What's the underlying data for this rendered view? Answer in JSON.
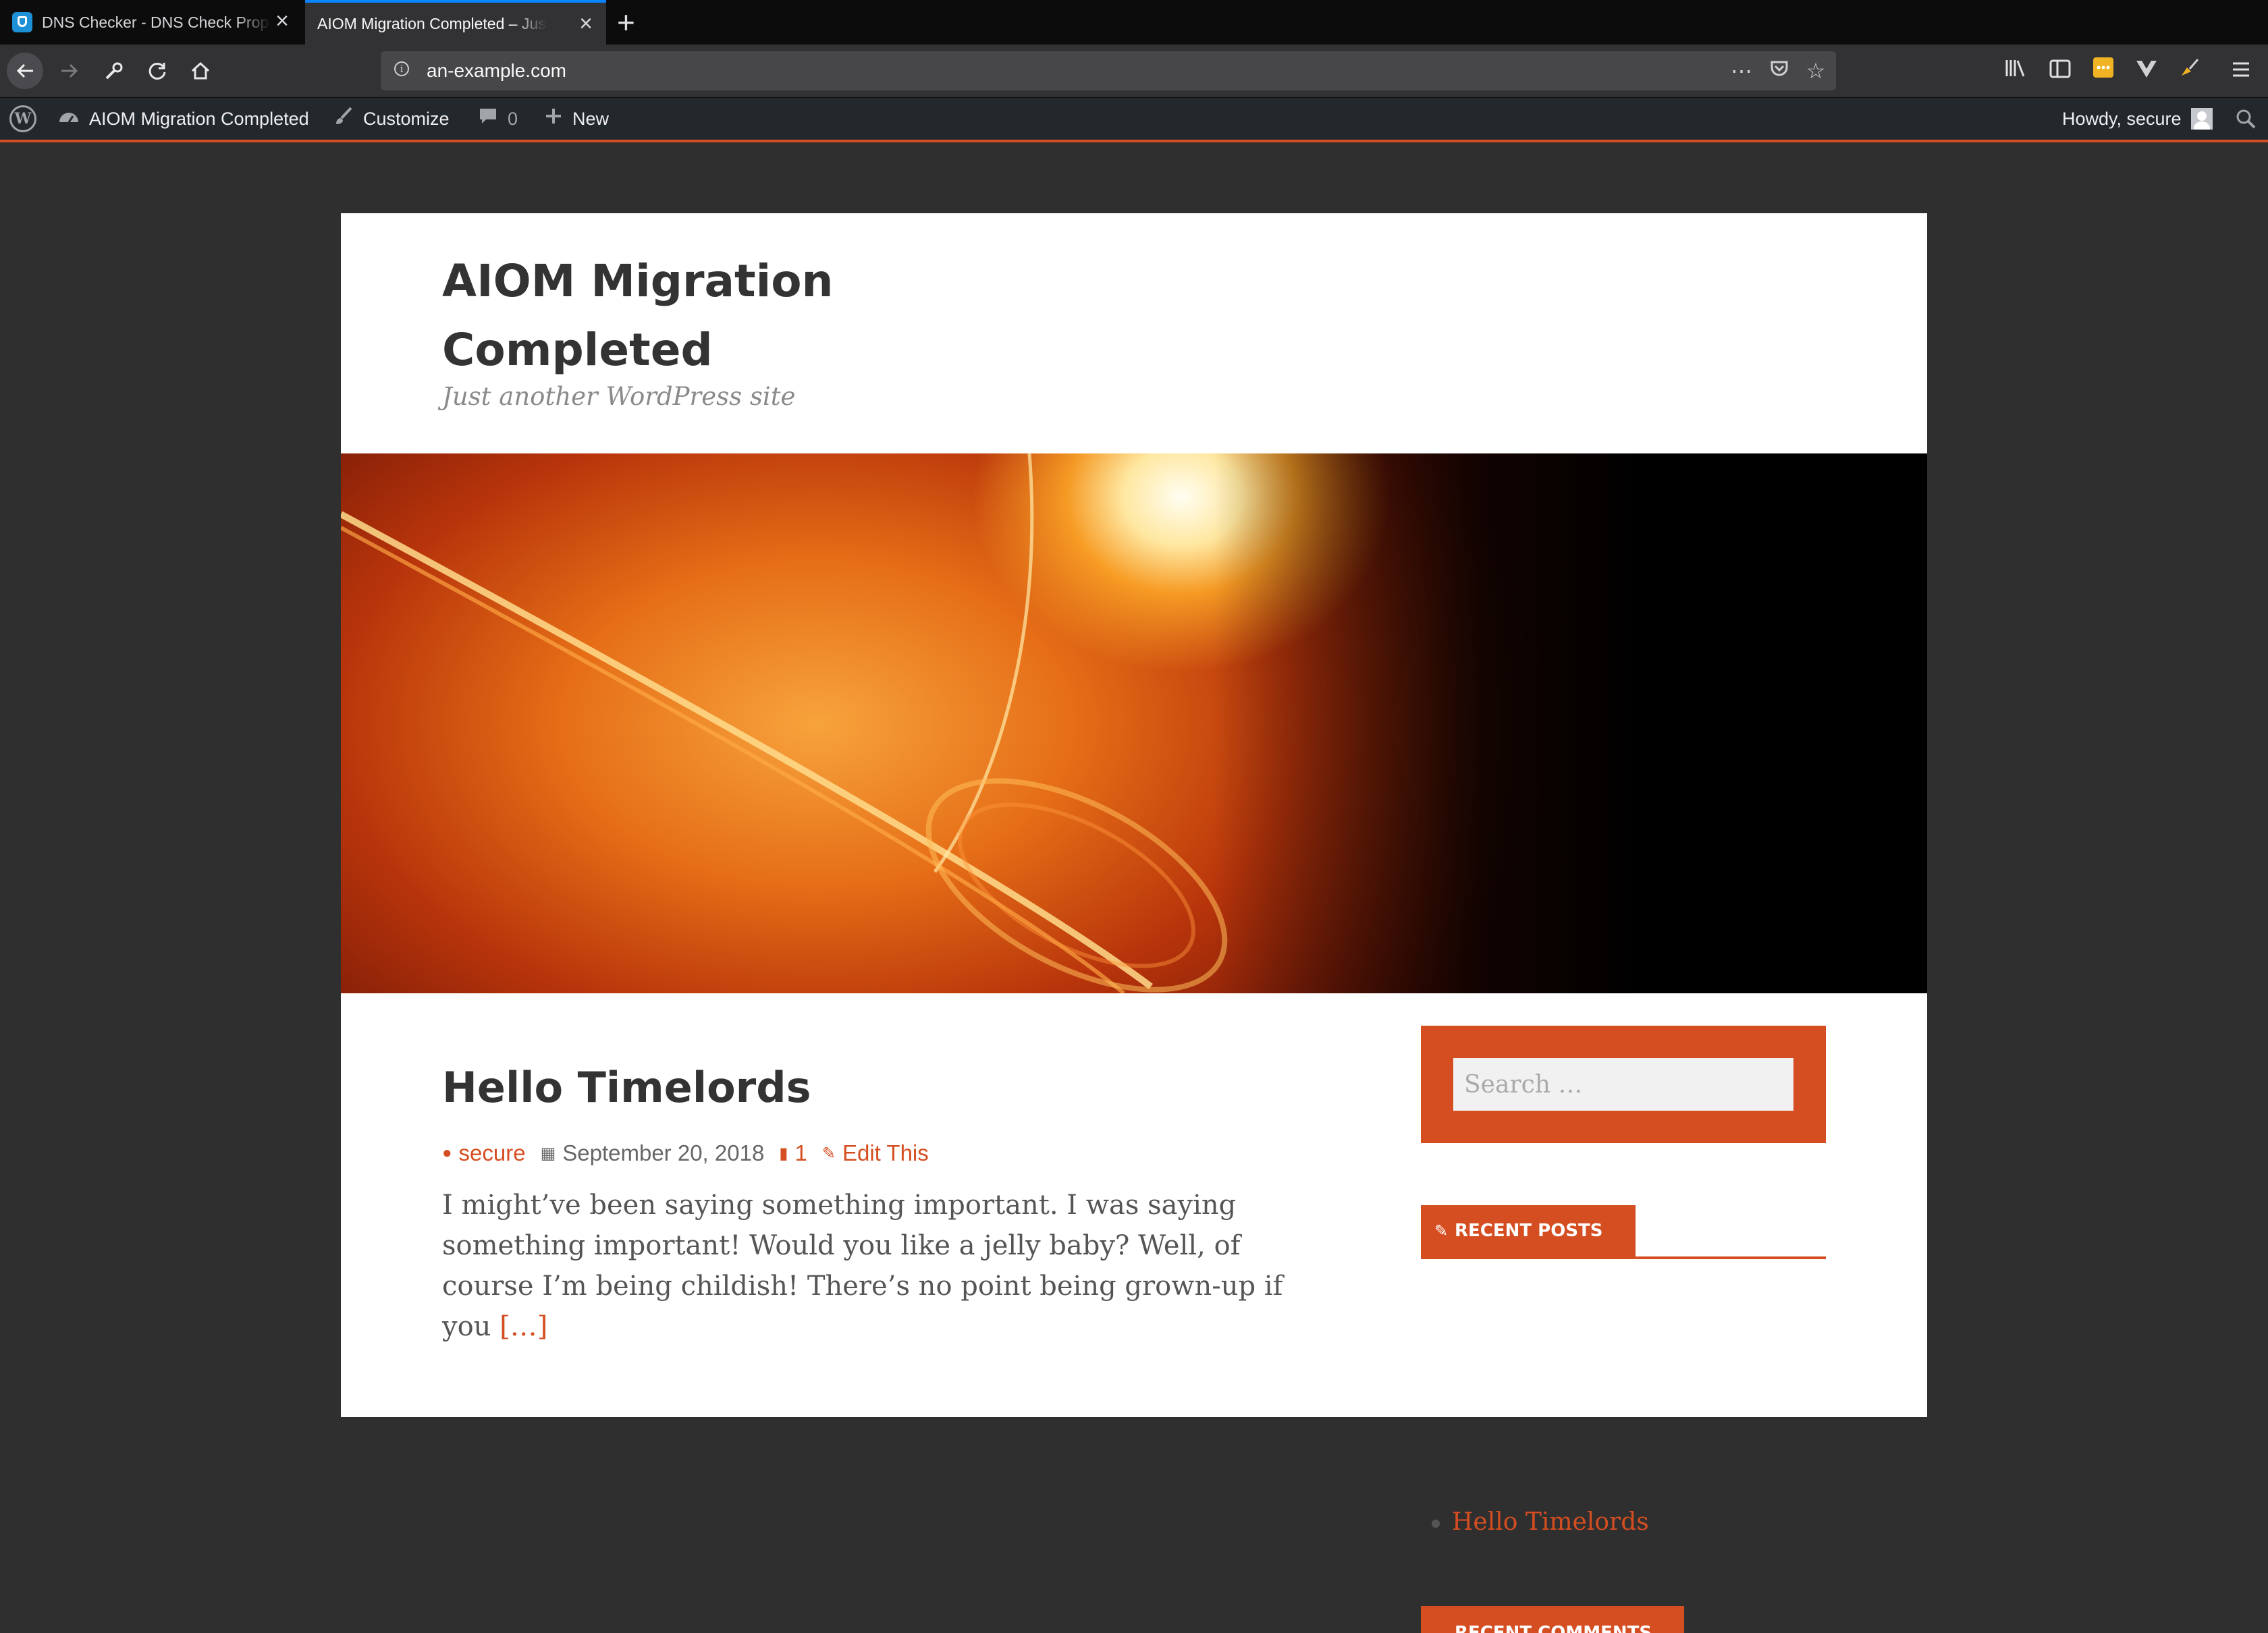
{
  "browser": {
    "tabs": [
      {
        "title": "DNS Checker - DNS Check Propagation",
        "active": false
      },
      {
        "title": "AIOM Migration Completed – Just another WordPress site",
        "active": true
      }
    ],
    "new_tab": "+",
    "url": "an-example.com",
    "icons": {
      "back": "arrow-left-icon",
      "forward": "arrow-right-icon",
      "tools": "wrench-icon",
      "reload": "reload-icon",
      "home": "home-icon",
      "page_actions": "more-horizontal-icon",
      "pocket": "pocket-icon",
      "bookmark": "star-icon",
      "library": "library-icon",
      "sidebar": "sidebar-icon",
      "menu": "hamburger-icon"
    },
    "accent_color": "#0a84ff"
  },
  "adminbar": {
    "site_name": "AIOM Migration Completed",
    "customize": "Customize",
    "comments_count": "0",
    "new_label": "New",
    "howdy": "Howdy, secure"
  },
  "site": {
    "title": "AIOM Migration Completed",
    "tagline": "Just another WordPress site",
    "accent_color": "#d54e21"
  },
  "post": {
    "title": "Hello Timelords",
    "author": "secure",
    "date": "September 20, 2018",
    "comments": "1",
    "edit": "Edit This",
    "excerpt": "I might’ve been saying something important. I was saying something important! Would you like a jelly baby? Well, of course I’m being childish! There’s no point being grown-up if you ",
    "more": "[…]"
  },
  "sidebar": {
    "search_placeholder": "Search …",
    "recent_posts_title": "RECENT POSTS",
    "recent_posts": [
      "Hello Timelords"
    ],
    "recent_comments_title": "RECENT COMMENTS"
  }
}
